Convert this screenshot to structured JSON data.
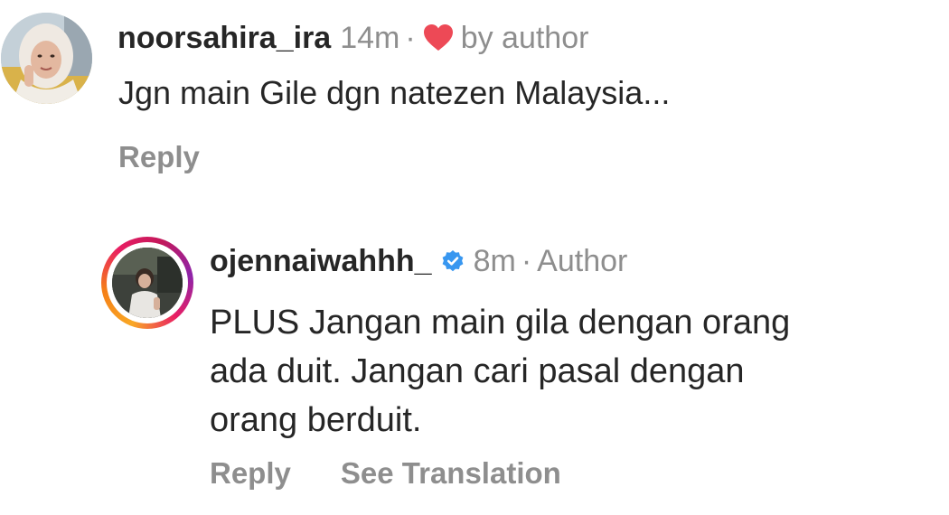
{
  "comment": {
    "username": "noorsahira_ira",
    "time": "14m",
    "separator": "·",
    "liked_by_label": "by author",
    "text": "Jgn main Gile dgn natezen Malaysia...",
    "reply_label": "Reply"
  },
  "reply": {
    "username": "ojennaiwahhh_",
    "time": "8m",
    "separator": "·",
    "author_label": "Author",
    "text_lines": [
      "PLUS Jangan main gila dengan orang",
      "ada duit. Jangan cari pasal dengan",
      "orang berduit."
    ],
    "reply_label": "Reply",
    "translate_label": "See Translation"
  },
  "colors": {
    "text_primary": "#262626",
    "text_secondary": "#8e8e8e",
    "heart": "#ed4956",
    "verified": "#3897f0"
  },
  "icons": {
    "like": "heart-icon",
    "verified": "verified-badge-icon"
  }
}
